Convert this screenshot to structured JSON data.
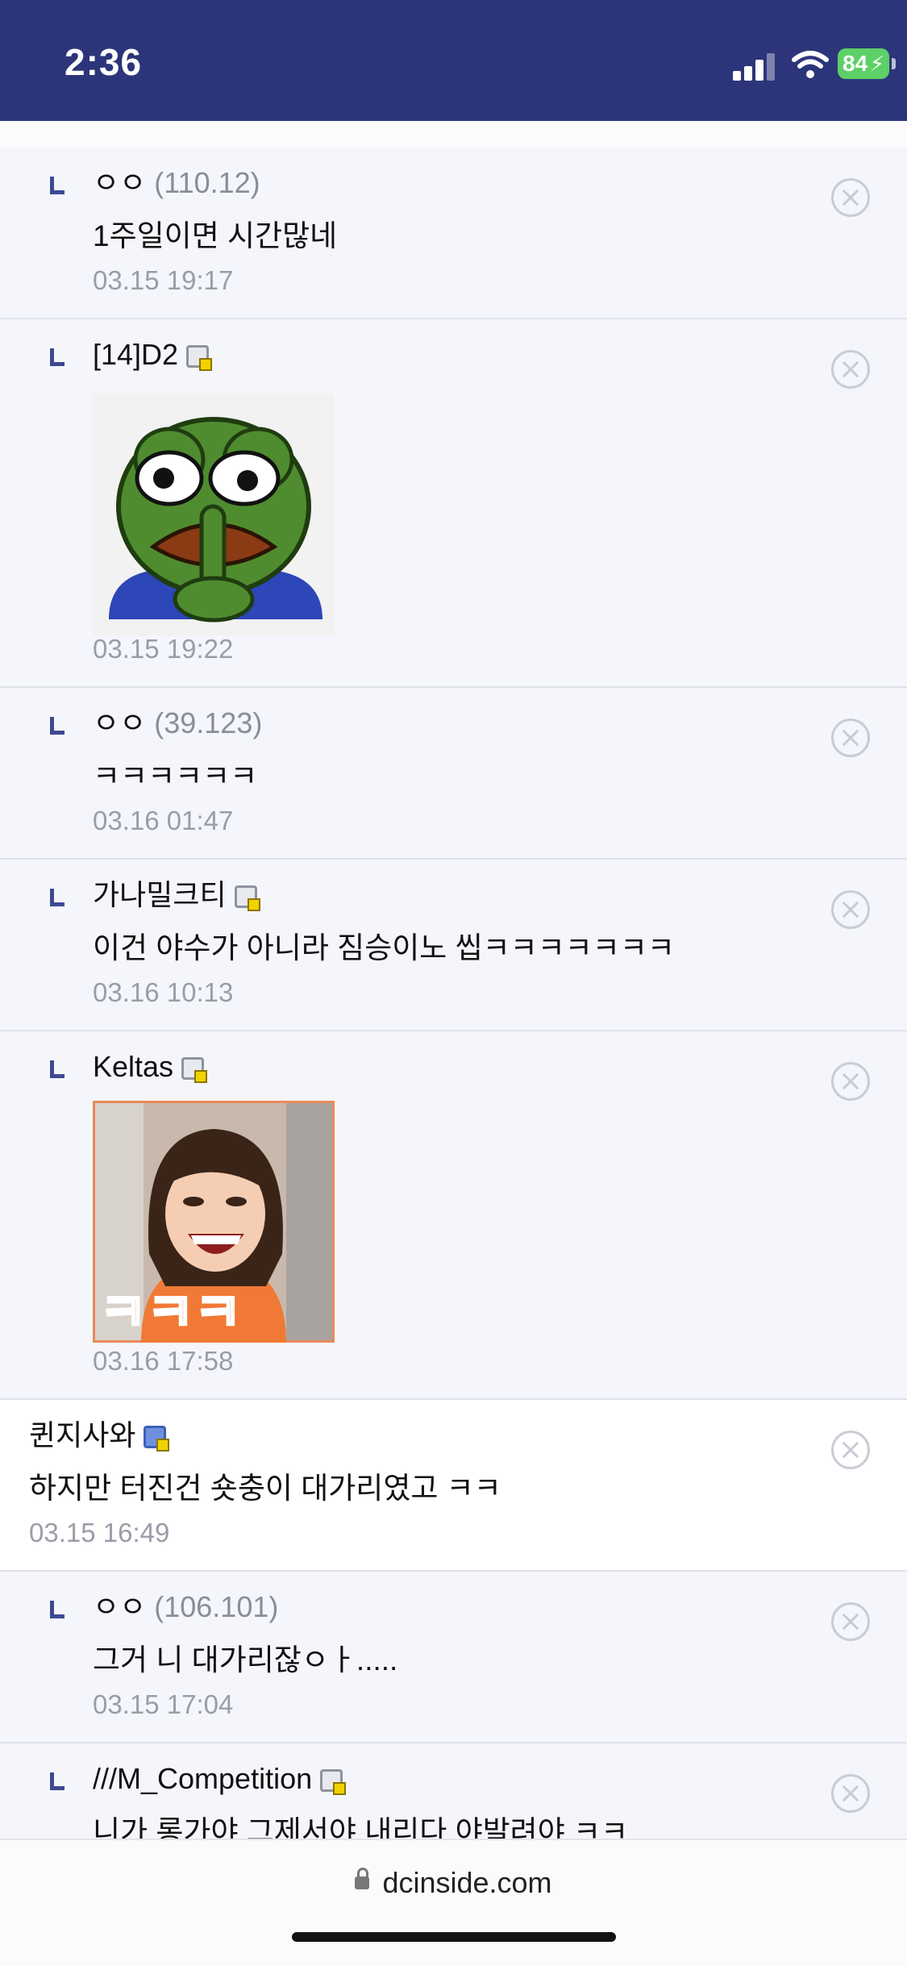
{
  "status_bar": {
    "time": "2:36",
    "battery": "84"
  },
  "comments": [
    {
      "reply": true,
      "name": "ㅇㅇ",
      "ip": "(110.12)",
      "text": "1주일이면 시간많네",
      "date": "03.15 19:17"
    },
    {
      "reply": true,
      "name": "[14]D2",
      "badge": "gallery-badge",
      "dccon": "pepe-shush-sticker",
      "date": "03.15 19:22"
    },
    {
      "reply": true,
      "name": "ㅇㅇ",
      "ip": "(39.123)",
      "text": "ㅋㅋㅋㅋㅋㅋ",
      "date": "03.16 01:47"
    },
    {
      "reply": true,
      "name": "가나밀크티",
      "badge": "gallery-badge",
      "text": "이건 야수가 아니라 짐승이노 씹ㅋㅋㅋㅋㅋㅋㅋ",
      "date": "03.16 10:13"
    },
    {
      "reply": true,
      "name": "Keltas",
      "badge": "gallery-badge",
      "dccon": "laughing-girl-sticker",
      "sticker_text": "ㅋㅋㅋ",
      "date": "03.16 17:58"
    },
    {
      "reply": false,
      "name": "퀸지사와",
      "badge": "fixed-nick-badge",
      "text": "하지만 터진건 숏충이 대가리였고 ㅋㅋ",
      "date": "03.15 16:49"
    },
    {
      "reply": true,
      "name": "ㅇㅇ",
      "ip": "(106.101)",
      "text": "그거 니 대가리잖ㅇㅏ.....",
      "date": "03.15 17:04"
    },
    {
      "reply": true,
      "name": "///M_Competition",
      "badge": "gallery-badge",
      "text": "니가 롱가야 그제서야 내리다 야발려야 ㅋㅋ"
    }
  ],
  "browser": {
    "url": "dcinside.com"
  },
  "colors": {
    "header": "#2c3579",
    "reply_mark": "#3d4a91",
    "battery": "#5dd067"
  }
}
